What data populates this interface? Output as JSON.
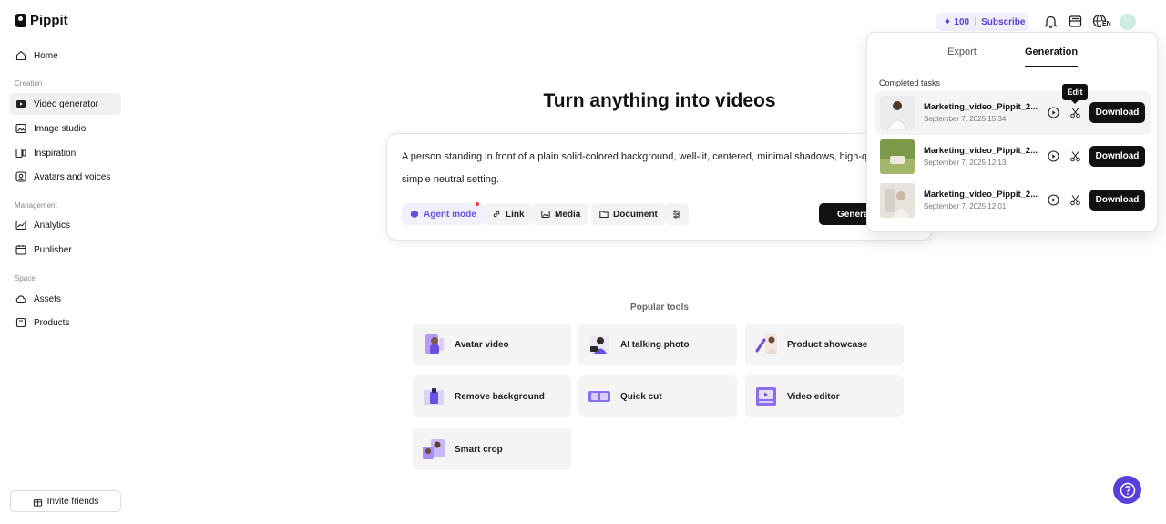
{
  "app": {
    "name": "Pippit"
  },
  "sidebar": {
    "home": "Home",
    "sections": {
      "creation": "Creation",
      "management": "Management",
      "space": "Space"
    },
    "items": {
      "video_generator": "Video generator",
      "image_studio": "Image studio",
      "inspiration": "Inspiration",
      "avatars_voices": "Avatars and voices",
      "analytics": "Analytics",
      "publisher": "Publisher",
      "assets": "Assets",
      "products": "Products"
    },
    "active_item": "Video generator",
    "invite": "Invite friends"
  },
  "topbar": {
    "credits": "100",
    "subscribe": "Subscribe",
    "language": "EN",
    "icons": [
      "credit-sparkle-icon",
      "bell-icon",
      "inbox-icon",
      "globe-language-icon",
      "user-avatar"
    ]
  },
  "main": {
    "headline": "Turn anything into videos",
    "prompt": "A person standing in front of a plain solid-colored background, well-lit, centered, minimal shadows, high-quality, simple neutral setting.",
    "chips": {
      "agent": "Agent mode",
      "link": "Link",
      "media": "Media",
      "document": "Document"
    },
    "generate": "Generate",
    "popular_title": "Popular tools",
    "tools": [
      {
        "label": "Avatar video"
      },
      {
        "label": "AI talking photo"
      },
      {
        "label": "Product showcase"
      },
      {
        "label": "Remove background"
      },
      {
        "label": "Quick cut"
      },
      {
        "label": "Video editor"
      },
      {
        "label": "Smart crop"
      }
    ]
  },
  "panel": {
    "tabs": {
      "export": "Export",
      "generation": "Generation"
    },
    "active_tab": "Generation",
    "completed_label": "Completed tasks",
    "tooltip": "Edit",
    "download_label": "Download",
    "tasks": [
      {
        "name": "Marketing_video_Pippit_2...",
        "date": "September 7, 2025 15:34"
      },
      {
        "name": "Marketing_video_Pippit_2...",
        "date": "September 7, 2025 12:13"
      },
      {
        "name": "Marketing_video_Pippit_2...",
        "date": "September 7, 2025 12:01"
      }
    ]
  },
  "colors": {
    "accent": "#5b3fd9",
    "agent_chip_text": "#6a4fe0",
    "active_nav_bg": "#eef0f2",
    "button_dark": "#111111"
  }
}
